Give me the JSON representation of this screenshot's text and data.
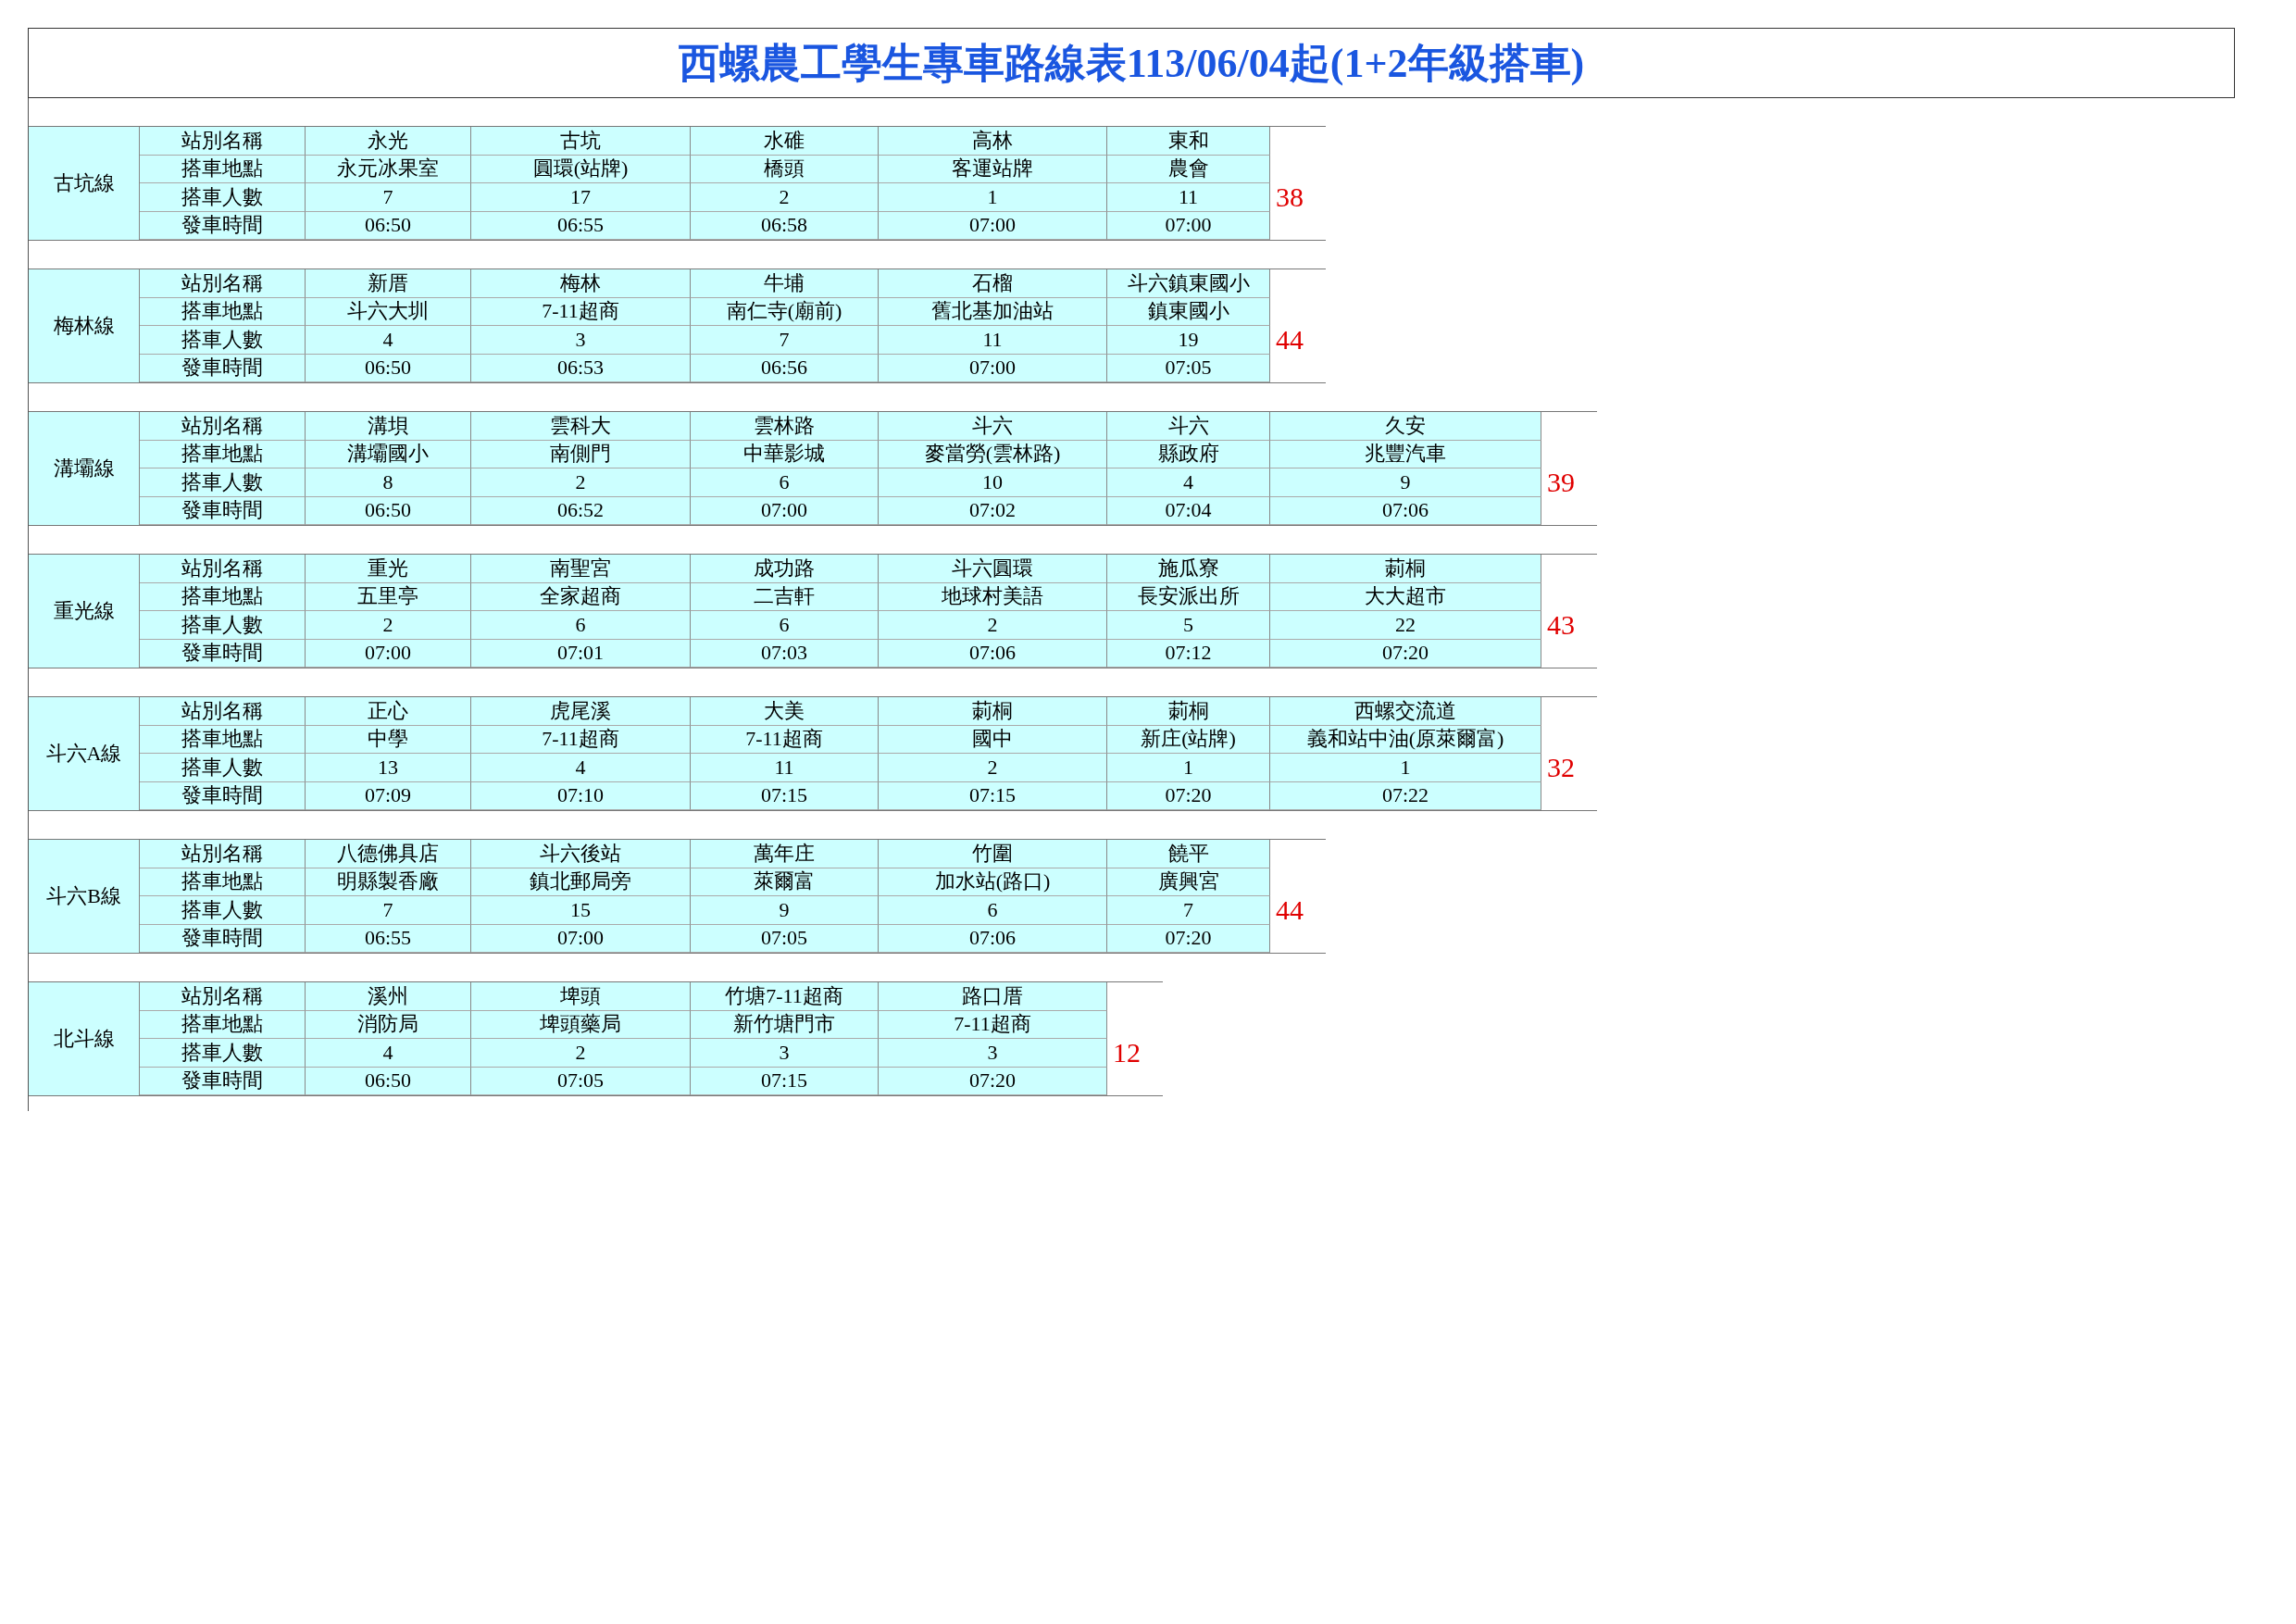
{
  "title": "西螺農工學生專車路線表113/06/04起(1+2年級搭車)",
  "routes": [
    {
      "name": "古坑線",
      "total": "38",
      "rows": [
        {
          "label": "站別名稱",
          "cells": [
            "永光",
            "古坑",
            "水碓",
            "高林",
            "東和"
          ]
        },
        {
          "label": "搭車地點",
          "cells": [
            "永元冰果室",
            "圓環(站牌)",
            "橋頭",
            "客運站牌",
            "農會"
          ]
        },
        {
          "label": "搭車人數",
          "cells": [
            "7",
            "17",
            "2",
            "1",
            "11"
          ]
        },
        {
          "label": "發車時間",
          "cells": [
            "06:50",
            "06:55",
            "06:58",
            "07:00",
            "07:00"
          ]
        }
      ]
    },
    {
      "name": "梅林線",
      "total": "44",
      "rows": [
        {
          "label": "站別名稱",
          "cells": [
            "新厝",
            "梅林",
            "牛埔",
            "石榴",
            "斗六鎮東國小"
          ]
        },
        {
          "label": "搭車地點",
          "cells": [
            "斗六大圳",
            "7-11超商",
            "南仁寺(廟前)",
            "舊北基加油站",
            "鎮東國小"
          ]
        },
        {
          "label": "搭車人數",
          "cells": [
            "4",
            "3",
            "7",
            "11",
            "19"
          ]
        },
        {
          "label": "發車時間",
          "cells": [
            "06:50",
            "06:53",
            "06:56",
            "07:00",
            "07:05"
          ]
        }
      ]
    },
    {
      "name": "溝壩線",
      "total": "39",
      "rows": [
        {
          "label": "站別名稱",
          "cells": [
            "溝垻",
            "雲科大",
            "雲林路",
            "斗六",
            "斗六",
            "久安"
          ]
        },
        {
          "label": "搭車地點",
          "cells": [
            "溝壩國小",
            "南側門",
            "中華影城",
            "麥當勞(雲林路)",
            "縣政府",
            "兆豐汽車"
          ]
        },
        {
          "label": "搭車人數",
          "cells": [
            "8",
            "2",
            "6",
            "10",
            "4",
            "9"
          ]
        },
        {
          "label": "發車時間",
          "cells": [
            "06:50",
            "06:52",
            "07:00",
            "07:02",
            "07:04",
            "07:06"
          ]
        }
      ]
    },
    {
      "name": "重光線",
      "total": "43",
      "rows": [
        {
          "label": "站別名稱",
          "cells": [
            "重光",
            "南聖宮",
            "成功路",
            "斗六圓環",
            "施瓜寮",
            "莿桐"
          ]
        },
        {
          "label": "搭車地點",
          "cells": [
            "五里亭",
            "全家超商",
            "二吉軒",
            "地球村美語",
            "長安派出所",
            "大大超市"
          ]
        },
        {
          "label": "搭車人數",
          "cells": [
            "2",
            "6",
            "6",
            "2",
            "5",
            "22"
          ]
        },
        {
          "label": "發車時間",
          "cells": [
            "07:00",
            "07:01",
            "07:03",
            "07:06",
            "07:12",
            "07:20"
          ]
        }
      ]
    },
    {
      "name": "斗六A線",
      "total": "32",
      "rows": [
        {
          "label": "站別名稱",
          "cells": [
            "正心",
            "虎尾溪",
            "大美",
            "莿桐",
            "莿桐",
            "西螺交流道"
          ]
        },
        {
          "label": "搭車地點",
          "cells": [
            "中學",
            "7-11超商",
            "7-11超商",
            "國中",
            "新庄(站牌)",
            "義和站中油(原萊爾富)"
          ]
        },
        {
          "label": "搭車人數",
          "cells": [
            "13",
            "4",
            "11",
            "2",
            "1",
            "1"
          ]
        },
        {
          "label": "發車時間",
          "cells": [
            "07:09",
            "07:10",
            "07:15",
            "07:15",
            "07:20",
            "07:22"
          ]
        }
      ]
    },
    {
      "name": "斗六B線",
      "total": "44",
      "rows": [
        {
          "label": "站別名稱",
          "cells": [
            "八德佛具店",
            "斗六後站",
            "萬年庄",
            "竹圍",
            "饒平"
          ]
        },
        {
          "label": "搭車地點",
          "cells": [
            "明縣製香廠",
            "鎮北郵局旁",
            "萊爾富",
            "加水站(路口)",
            "廣興宮"
          ]
        },
        {
          "label": "搭車人數",
          "cells": [
            "7",
            "15",
            "9",
            "6",
            "7"
          ]
        },
        {
          "label": "發車時間",
          "cells": [
            "06:55",
            "07:00",
            "07:05",
            "07:06",
            "07:20"
          ]
        }
      ]
    },
    {
      "name": "北斗線",
      "total": "12",
      "rows": [
        {
          "label": "站別名稱",
          "cells": [
            "溪州",
            "埤頭",
            "竹塘7-11超商",
            "路口厝"
          ]
        },
        {
          "label": "搭車地點",
          "cells": [
            "消防局",
            "埤頭藥局",
            "新竹塘門市",
            "7-11超商"
          ]
        },
        {
          "label": "搭車人數",
          "cells": [
            "4",
            "2",
            "3",
            "3"
          ]
        },
        {
          "label": "發車時間",
          "cells": [
            "06:50",
            "07:05",
            "07:15",
            "07:20"
          ]
        }
      ]
    }
  ]
}
